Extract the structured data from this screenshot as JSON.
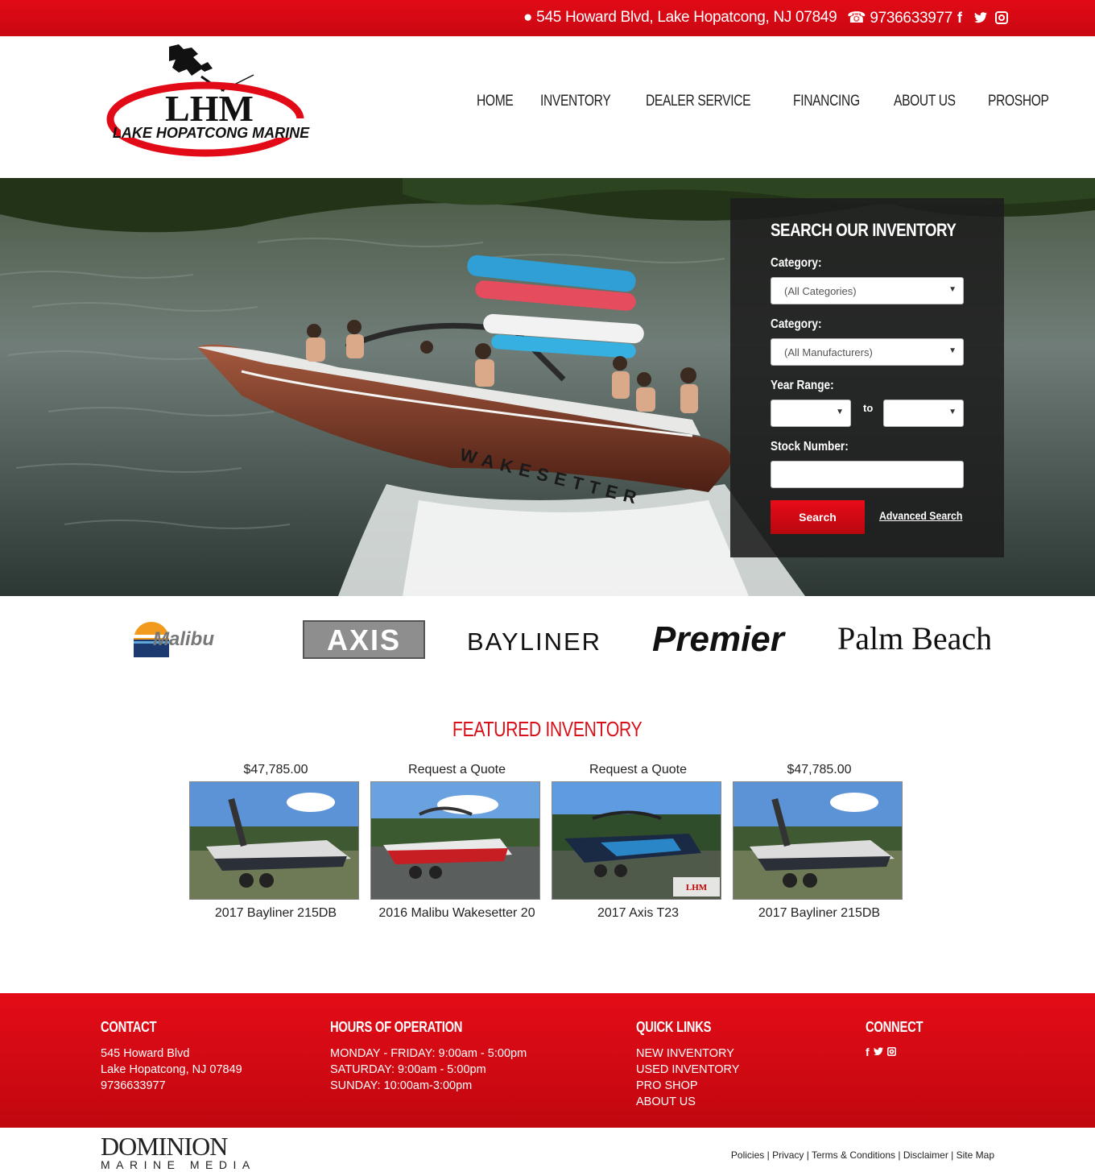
{
  "topbar": {
    "address": "545 Howard Blvd, Lake Hopatcong, NJ 07849",
    "phone": "9736633977",
    "social_icons": [
      "facebook-icon",
      "twitter-icon",
      "instagram-icon"
    ]
  },
  "logo": {
    "main": "LHM",
    "sub": "LAKE HOPATCONG MARINE"
  },
  "nav": [
    "HOME",
    "INVENTORY",
    "DEALER SERVICE",
    "FINANCING",
    "ABOUT US",
    "PROSHOP"
  ],
  "search": {
    "title": "SEARCH OUR INVENTORY",
    "category_label": "Category:",
    "category_value": "(All Categories)",
    "manufacturer_label": "Category:",
    "manufacturer_value": "(All Manufacturers)",
    "year_label": "Year Range:",
    "year_to": "to",
    "stock_label": "Stock Number:",
    "search_button": "Search",
    "advanced_link": "Advanced Search"
  },
  "hero": {
    "boat_text": "WAKESETTER"
  },
  "brands": [
    "Malibu",
    "AXIS",
    "BAYLINER",
    "Premier",
    "Palm Beach"
  ],
  "featured": {
    "title": "FEATURED INVENTORY",
    "items": [
      {
        "price": "$47,785.00",
        "name": "2017 Bayliner 215DB"
      },
      {
        "price": "Request a Quote",
        "name": "2016 Malibu Wakesetter 20"
      },
      {
        "price": "Request a Quote",
        "name": "2017 Axis T23"
      },
      {
        "price": "$47,785.00",
        "name": "2017 Bayliner 215DB"
      }
    ]
  },
  "footer": {
    "contact": {
      "title": "CONTACT",
      "line1": "545 Howard Blvd",
      "line2": "Lake Hopatcong, NJ 07849",
      "line3": "9736633977"
    },
    "hours": {
      "title": "HOURS OF OPERATION",
      "line1": "MONDAY - FRIDAY: 9:00am - 5:00pm",
      "line2": "SATURDAY: 9:00am - 5:00pm",
      "line3": "SUNDAY: 10:00am-3:00pm"
    },
    "links": {
      "title": "QUICK LINKS",
      "items": [
        "NEW INVENTORY",
        "USED INVENTORY",
        "PRO SHOP",
        "ABOUT US"
      ]
    },
    "connect": {
      "title": "CONNECT"
    }
  },
  "bottom": {
    "brand_big": "DOMINION",
    "brand_small": "MARINE MEDIA",
    "legal": [
      "Policies",
      "Privacy",
      "Terms & Conditions",
      "Disclaimer",
      "Site Map"
    ]
  },
  "colors": {
    "brand_red": "#e20a16",
    "panel_dark": "#1c1c1c"
  }
}
